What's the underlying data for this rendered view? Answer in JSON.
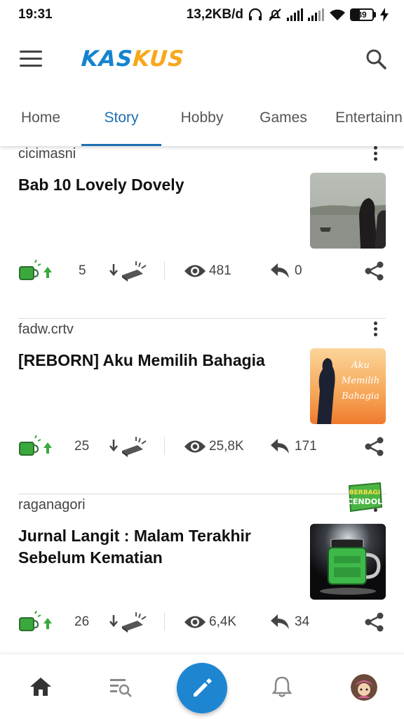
{
  "status_bar": {
    "time": "19:31",
    "speed": "13,2KB/d",
    "battery": "39",
    "icons": [
      "headphones-icon",
      "mute-icon",
      "signal-icon",
      "signal-icon",
      "wifi-icon",
      "battery-icon",
      "charging-icon"
    ]
  },
  "header": {
    "logo_k": "K",
    "logo_as": "AS",
    "logo_kus": "KUS",
    "icons": [
      "menu-icon",
      "search-icon"
    ]
  },
  "tabs": [
    {
      "label": "Home",
      "active": false
    },
    {
      "label": "Story",
      "active": true
    },
    {
      "label": "Hobby",
      "active": false
    },
    {
      "label": "Games",
      "active": false
    },
    {
      "label": "Entertainn",
      "active": false
    }
  ],
  "feed": [
    {
      "user": "cicimasni",
      "title": "Bab 10 Lovely Dovely",
      "cendol_count": "5",
      "views": "481",
      "replies": "0",
      "thumb": "lake-scene"
    },
    {
      "user": "fadw.crtv",
      "title": "[REBORN] Aku Memilih Bahagia",
      "cendol_count": "25",
      "views": "25,8K",
      "replies": "171",
      "thumb": "silhouette-sunset",
      "thumb_text": [
        "Aku",
        "Memilih",
        "Bahagia"
      ]
    },
    {
      "user": "raganagori",
      "title": "Jurnal Langit : Malam Terakhir Sebelum Kematian",
      "cendol_count": "26",
      "views": "6,4K",
      "replies": "34",
      "thumb": "cendol-jar",
      "badge": [
        "BERBAGI",
        "CENDOL"
      ]
    }
  ],
  "bottom_nav": {
    "icons": [
      "home-icon",
      "search-list-icon",
      "pencil-icon",
      "bell-icon",
      "avatar"
    ]
  },
  "colors": {
    "brand_blue": "#1484ce",
    "brand_orange": "#f7a81b",
    "tab_active": "#1e6fb3",
    "fab": "#1e86d1",
    "cendol_green": "#3aa83c"
  }
}
